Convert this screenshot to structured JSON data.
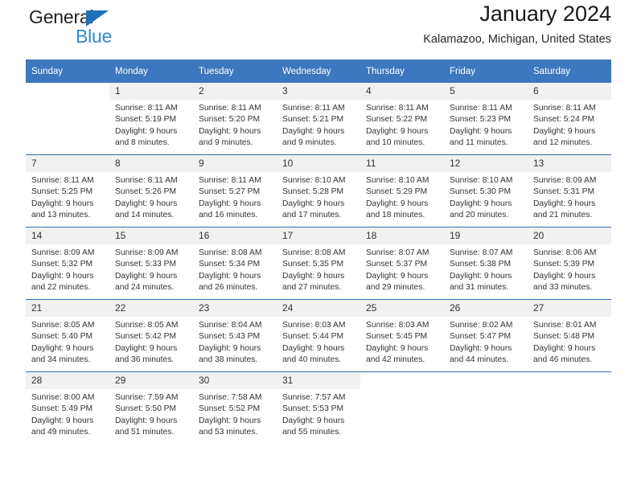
{
  "brand": {
    "name_part1": "General",
    "name_part2": "Blue",
    "triangle_color": "#1d71b8",
    "blue_color": "#2e8bd0"
  },
  "header": {
    "title": "January 2024",
    "subtitle": "Kalamazoo, Michigan, United States"
  },
  "theme": {
    "header_blue": "#3b78bd",
    "row_separator_blue": "#2f6fb3",
    "daynum_band": "#f1f1f1"
  },
  "calendar": {
    "weekday_headers": [
      "Sunday",
      "Monday",
      "Tuesday",
      "Wednesday",
      "Thursday",
      "Friday",
      "Saturday"
    ],
    "labels": {
      "sunrise_prefix": "Sunrise:",
      "sunset_prefix": "Sunset:",
      "daylight_prefix": "Daylight:"
    },
    "weeks": [
      [
        {
          "day": "",
          "empty": true
        },
        {
          "day": "1",
          "sunrise": "Sunrise: 8:11 AM",
          "sunset": "Sunset: 5:19 PM",
          "daylight_line1": "Daylight: 9 hours",
          "daylight_line2": "and 8 minutes."
        },
        {
          "day": "2",
          "sunrise": "Sunrise: 8:11 AM",
          "sunset": "Sunset: 5:20 PM",
          "daylight_line1": "Daylight: 9 hours",
          "daylight_line2": "and 9 minutes."
        },
        {
          "day": "3",
          "sunrise": "Sunrise: 8:11 AM",
          "sunset": "Sunset: 5:21 PM",
          "daylight_line1": "Daylight: 9 hours",
          "daylight_line2": "and 9 minutes."
        },
        {
          "day": "4",
          "sunrise": "Sunrise: 8:11 AM",
          "sunset": "Sunset: 5:22 PM",
          "daylight_line1": "Daylight: 9 hours",
          "daylight_line2": "and 10 minutes."
        },
        {
          "day": "5",
          "sunrise": "Sunrise: 8:11 AM",
          "sunset": "Sunset: 5:23 PM",
          "daylight_line1": "Daylight: 9 hours",
          "daylight_line2": "and 11 minutes."
        },
        {
          "day": "6",
          "sunrise": "Sunrise: 8:11 AM",
          "sunset": "Sunset: 5:24 PM",
          "daylight_line1": "Daylight: 9 hours",
          "daylight_line2": "and 12 minutes."
        }
      ],
      [
        {
          "day": "7",
          "sunrise": "Sunrise: 8:11 AM",
          "sunset": "Sunset: 5:25 PM",
          "daylight_line1": "Daylight: 9 hours",
          "daylight_line2": "and 13 minutes."
        },
        {
          "day": "8",
          "sunrise": "Sunrise: 8:11 AM",
          "sunset": "Sunset: 5:26 PM",
          "daylight_line1": "Daylight: 9 hours",
          "daylight_line2": "and 14 minutes."
        },
        {
          "day": "9",
          "sunrise": "Sunrise: 8:11 AM",
          "sunset": "Sunset: 5:27 PM",
          "daylight_line1": "Daylight: 9 hours",
          "daylight_line2": "and 16 minutes."
        },
        {
          "day": "10",
          "sunrise": "Sunrise: 8:10 AM",
          "sunset": "Sunset: 5:28 PM",
          "daylight_line1": "Daylight: 9 hours",
          "daylight_line2": "and 17 minutes."
        },
        {
          "day": "11",
          "sunrise": "Sunrise: 8:10 AM",
          "sunset": "Sunset: 5:29 PM",
          "daylight_line1": "Daylight: 9 hours",
          "daylight_line2": "and 18 minutes."
        },
        {
          "day": "12",
          "sunrise": "Sunrise: 8:10 AM",
          "sunset": "Sunset: 5:30 PM",
          "daylight_line1": "Daylight: 9 hours",
          "daylight_line2": "and 20 minutes."
        },
        {
          "day": "13",
          "sunrise": "Sunrise: 8:09 AM",
          "sunset": "Sunset: 5:31 PM",
          "daylight_line1": "Daylight: 9 hours",
          "daylight_line2": "and 21 minutes."
        }
      ],
      [
        {
          "day": "14",
          "sunrise": "Sunrise: 8:09 AM",
          "sunset": "Sunset: 5:32 PM",
          "daylight_line1": "Daylight: 9 hours",
          "daylight_line2": "and 22 minutes."
        },
        {
          "day": "15",
          "sunrise": "Sunrise: 8:09 AM",
          "sunset": "Sunset: 5:33 PM",
          "daylight_line1": "Daylight: 9 hours",
          "daylight_line2": "and 24 minutes."
        },
        {
          "day": "16",
          "sunrise": "Sunrise: 8:08 AM",
          "sunset": "Sunset: 5:34 PM",
          "daylight_line1": "Daylight: 9 hours",
          "daylight_line2": "and 26 minutes."
        },
        {
          "day": "17",
          "sunrise": "Sunrise: 8:08 AM",
          "sunset": "Sunset: 5:35 PM",
          "daylight_line1": "Daylight: 9 hours",
          "daylight_line2": "and 27 minutes."
        },
        {
          "day": "18",
          "sunrise": "Sunrise: 8:07 AM",
          "sunset": "Sunset: 5:37 PM",
          "daylight_line1": "Daylight: 9 hours",
          "daylight_line2": "and 29 minutes."
        },
        {
          "day": "19",
          "sunrise": "Sunrise: 8:07 AM",
          "sunset": "Sunset: 5:38 PM",
          "daylight_line1": "Daylight: 9 hours",
          "daylight_line2": "and 31 minutes."
        },
        {
          "day": "20",
          "sunrise": "Sunrise: 8:06 AM",
          "sunset": "Sunset: 5:39 PM",
          "daylight_line1": "Daylight: 9 hours",
          "daylight_line2": "and 33 minutes."
        }
      ],
      [
        {
          "day": "21",
          "sunrise": "Sunrise: 8:05 AM",
          "sunset": "Sunset: 5:40 PM",
          "daylight_line1": "Daylight: 9 hours",
          "daylight_line2": "and 34 minutes."
        },
        {
          "day": "22",
          "sunrise": "Sunrise: 8:05 AM",
          "sunset": "Sunset: 5:42 PM",
          "daylight_line1": "Daylight: 9 hours",
          "daylight_line2": "and 36 minutes."
        },
        {
          "day": "23",
          "sunrise": "Sunrise: 8:04 AM",
          "sunset": "Sunset: 5:43 PM",
          "daylight_line1": "Daylight: 9 hours",
          "daylight_line2": "and 38 minutes."
        },
        {
          "day": "24",
          "sunrise": "Sunrise: 8:03 AM",
          "sunset": "Sunset: 5:44 PM",
          "daylight_line1": "Daylight: 9 hours",
          "daylight_line2": "and 40 minutes."
        },
        {
          "day": "25",
          "sunrise": "Sunrise: 8:03 AM",
          "sunset": "Sunset: 5:45 PM",
          "daylight_line1": "Daylight: 9 hours",
          "daylight_line2": "and 42 minutes."
        },
        {
          "day": "26",
          "sunrise": "Sunrise: 8:02 AM",
          "sunset": "Sunset: 5:47 PM",
          "daylight_line1": "Daylight: 9 hours",
          "daylight_line2": "and 44 minutes."
        },
        {
          "day": "27",
          "sunrise": "Sunrise: 8:01 AM",
          "sunset": "Sunset: 5:48 PM",
          "daylight_line1": "Daylight: 9 hours",
          "daylight_line2": "and 46 minutes."
        }
      ],
      [
        {
          "day": "28",
          "sunrise": "Sunrise: 8:00 AM",
          "sunset": "Sunset: 5:49 PM",
          "daylight_line1": "Daylight: 9 hours",
          "daylight_line2": "and 49 minutes."
        },
        {
          "day": "29",
          "sunrise": "Sunrise: 7:59 AM",
          "sunset": "Sunset: 5:50 PM",
          "daylight_line1": "Daylight: 9 hours",
          "daylight_line2": "and 51 minutes."
        },
        {
          "day": "30",
          "sunrise": "Sunrise: 7:58 AM",
          "sunset": "Sunset: 5:52 PM",
          "daylight_line1": "Daylight: 9 hours",
          "daylight_line2": "and 53 minutes."
        },
        {
          "day": "31",
          "sunrise": "Sunrise: 7:57 AM",
          "sunset": "Sunset: 5:53 PM",
          "daylight_line1": "Daylight: 9 hours",
          "daylight_line2": "and 55 minutes."
        },
        {
          "day": "",
          "empty": true
        },
        {
          "day": "",
          "empty": true
        },
        {
          "day": "",
          "empty": true
        }
      ]
    ]
  }
}
